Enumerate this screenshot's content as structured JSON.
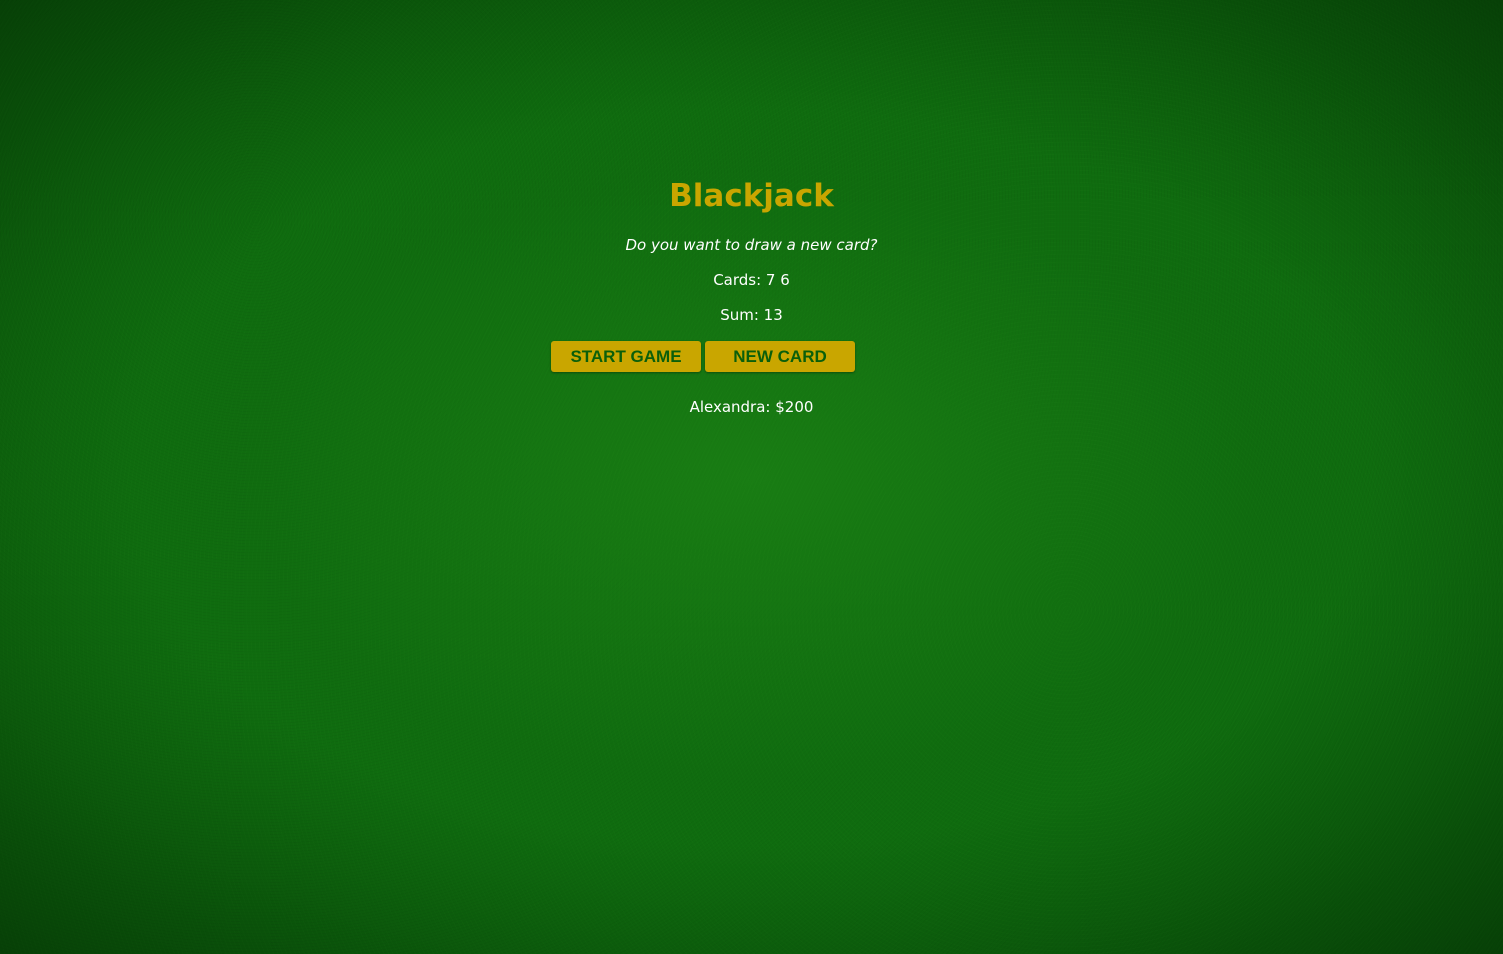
{
  "game": {
    "title": "Blackjack",
    "message": "Do you want to draw a new card?",
    "cards_text": "Cards: 7 6",
    "sum_text": "Sum: 13",
    "player_text": "Alexandra: $200"
  },
  "buttons": {
    "start_label": "START GAME",
    "new_card_label": "NEW CARD"
  },
  "colors": {
    "felt": "#0e6b0e",
    "accent_gold": "#c9a600",
    "button_text": "#0a5f0a",
    "text": "#ffffff"
  }
}
